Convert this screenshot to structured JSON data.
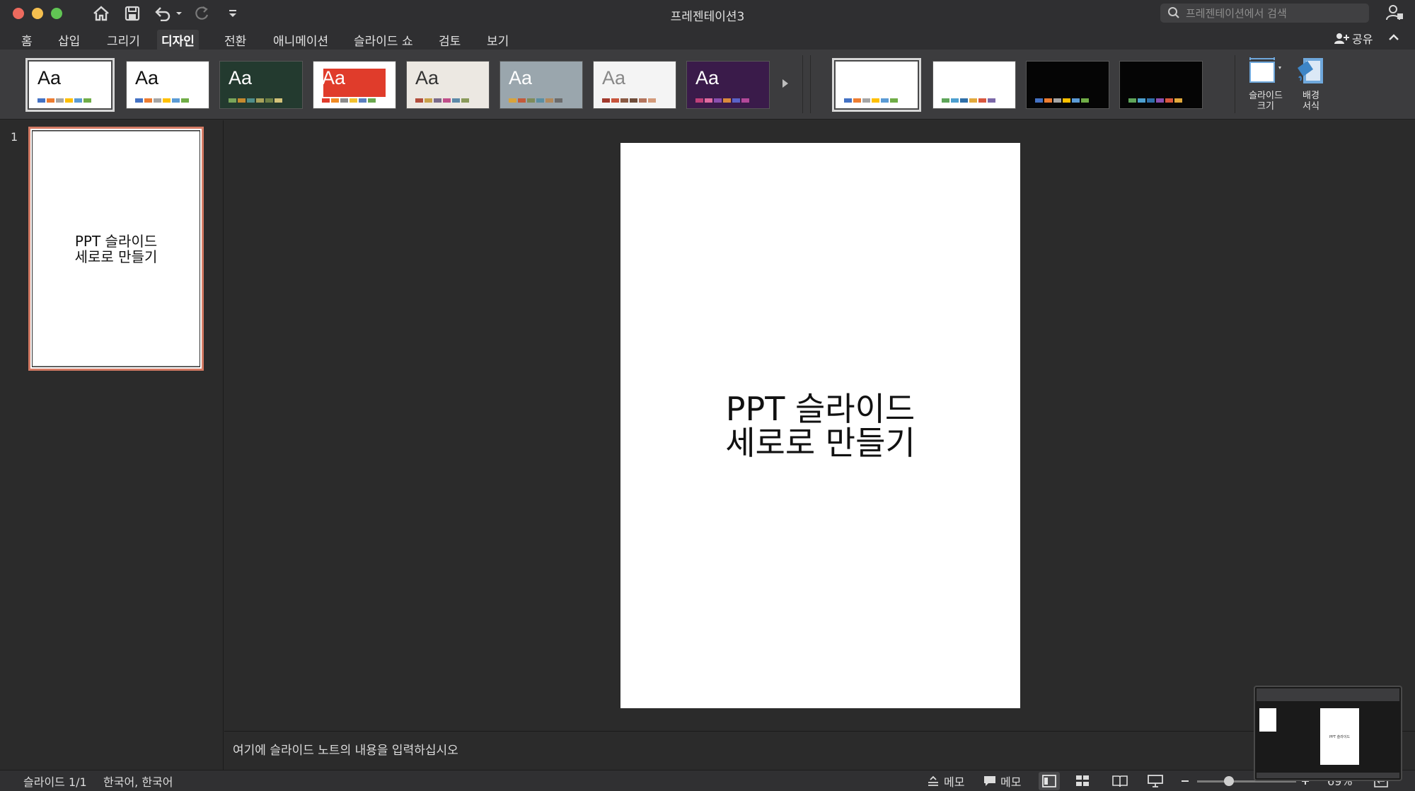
{
  "window": {
    "title": "프레젠테이션3"
  },
  "search": {
    "placeholder": "프레젠테이션에서 검색"
  },
  "tabs": [
    {
      "label": "홈"
    },
    {
      "label": "삽입"
    },
    {
      "label": "그리기"
    },
    {
      "label": "디자인",
      "active": true
    },
    {
      "label": "전환"
    },
    {
      "label": "애니메이션"
    },
    {
      "label": "슬라이드 쇼"
    },
    {
      "label": "검토"
    },
    {
      "label": "보기"
    }
  ],
  "share": {
    "label": "공유"
  },
  "ribbon": {
    "theme_sample": "Aa",
    "themes": [
      {
        "bg": "#ffffff",
        "fg": "#111111",
        "swatches": [
          "#4472c4",
          "#ed7d31",
          "#a5a5a5",
          "#ffc000",
          "#5b9bd5",
          "#70ad47"
        ]
      },
      {
        "bg": "#ffffff",
        "fg": "#111111",
        "swatches": [
          "#4472c4",
          "#ed7d31",
          "#a5a5a5",
          "#ffc000",
          "#5b9bd5",
          "#70ad47"
        ]
      },
      {
        "bg": "#233a2f",
        "fg": "#ffffff",
        "swatches": [
          "#7aa65a",
          "#c58a2e",
          "#4f8e8a",
          "#a8a25b",
          "#6c7f45",
          "#d3c37a"
        ]
      },
      {
        "bg": "#ffffff",
        "fg": "#ffffff",
        "accent": "#e03c2b",
        "swatches": [
          "#e03c2b",
          "#f08a24",
          "#8c8c8c",
          "#f2c12e",
          "#5a7fbf",
          "#6aa84f"
        ]
      },
      {
        "bg": "#ece8e2",
        "fg": "#333333",
        "swatches": [
          "#b24d3c",
          "#c9a14a",
          "#7a6a8a",
          "#c04f8a",
          "#5d8aa8",
          "#8a9a5b"
        ]
      },
      {
        "bg": "#9aa6ad",
        "fg": "#ffffff",
        "swatches": [
          "#d9a43b",
          "#c45a3a",
          "#7e8c5a",
          "#5a8fa3",
          "#b38a5c",
          "#6b6b6b"
        ]
      },
      {
        "bg": "#f4f4f4",
        "fg": "#888888",
        "swatches": [
          "#a23a2e",
          "#c8553d",
          "#8a5a44",
          "#6e4c3a",
          "#b3745c",
          "#d39a7a"
        ]
      },
      {
        "bg": "#3a1b4a",
        "fg": "#ffffff",
        "swatches": [
          "#c0407a",
          "#e06aa0",
          "#8a4fb0",
          "#d98a3c",
          "#5a62c8",
          "#b3489a"
        ]
      }
    ],
    "variants": [
      {
        "bg": "#ffffff",
        "swatches": [
          "#4472c4",
          "#ed7d31",
          "#a5a5a5",
          "#ffc000",
          "#5b9bd5",
          "#70ad47"
        ]
      },
      {
        "bg": "#ffffff",
        "swatches": [
          "#5fa55a",
          "#4d9fcf",
          "#2f6fa8",
          "#e2a93b",
          "#d9573e",
          "#7b68a8"
        ]
      },
      {
        "bg": "#050505",
        "swatches": [
          "#4472c4",
          "#ed7d31",
          "#a5a5a5",
          "#ffc000",
          "#5b9bd5",
          "#70ad47"
        ]
      },
      {
        "bg": "#050505",
        "swatches": [
          "#5fa55a",
          "#4d9fcf",
          "#2f6fa8",
          "#8a4fb0",
          "#d9573e",
          "#e2a93b"
        ]
      }
    ],
    "slide_size_label": "슬라이드\n크기",
    "format_bg_label": "배경\n서식"
  },
  "slides": {
    "count_label": "1",
    "thumb_text_line1": "PPT 슬라이드",
    "thumb_text_line2": "세로로 만들기"
  },
  "slide": {
    "line1": "PPT 슬라이드",
    "line2": "세로로 만들기"
  },
  "notes": {
    "placeholder": "여기에 슬라이드 노트의 내용을 입력하십시오"
  },
  "status": {
    "slide_pos": "슬라이드 1/1",
    "language": "한국어, 한국어",
    "notes_label": "메모",
    "comments_label": "메모",
    "zoom_label": "69%"
  },
  "colors": {
    "accent_selection": "#d47a64",
    "titlebar": "#2f2f31",
    "ribbon": "#3c3c3e"
  }
}
